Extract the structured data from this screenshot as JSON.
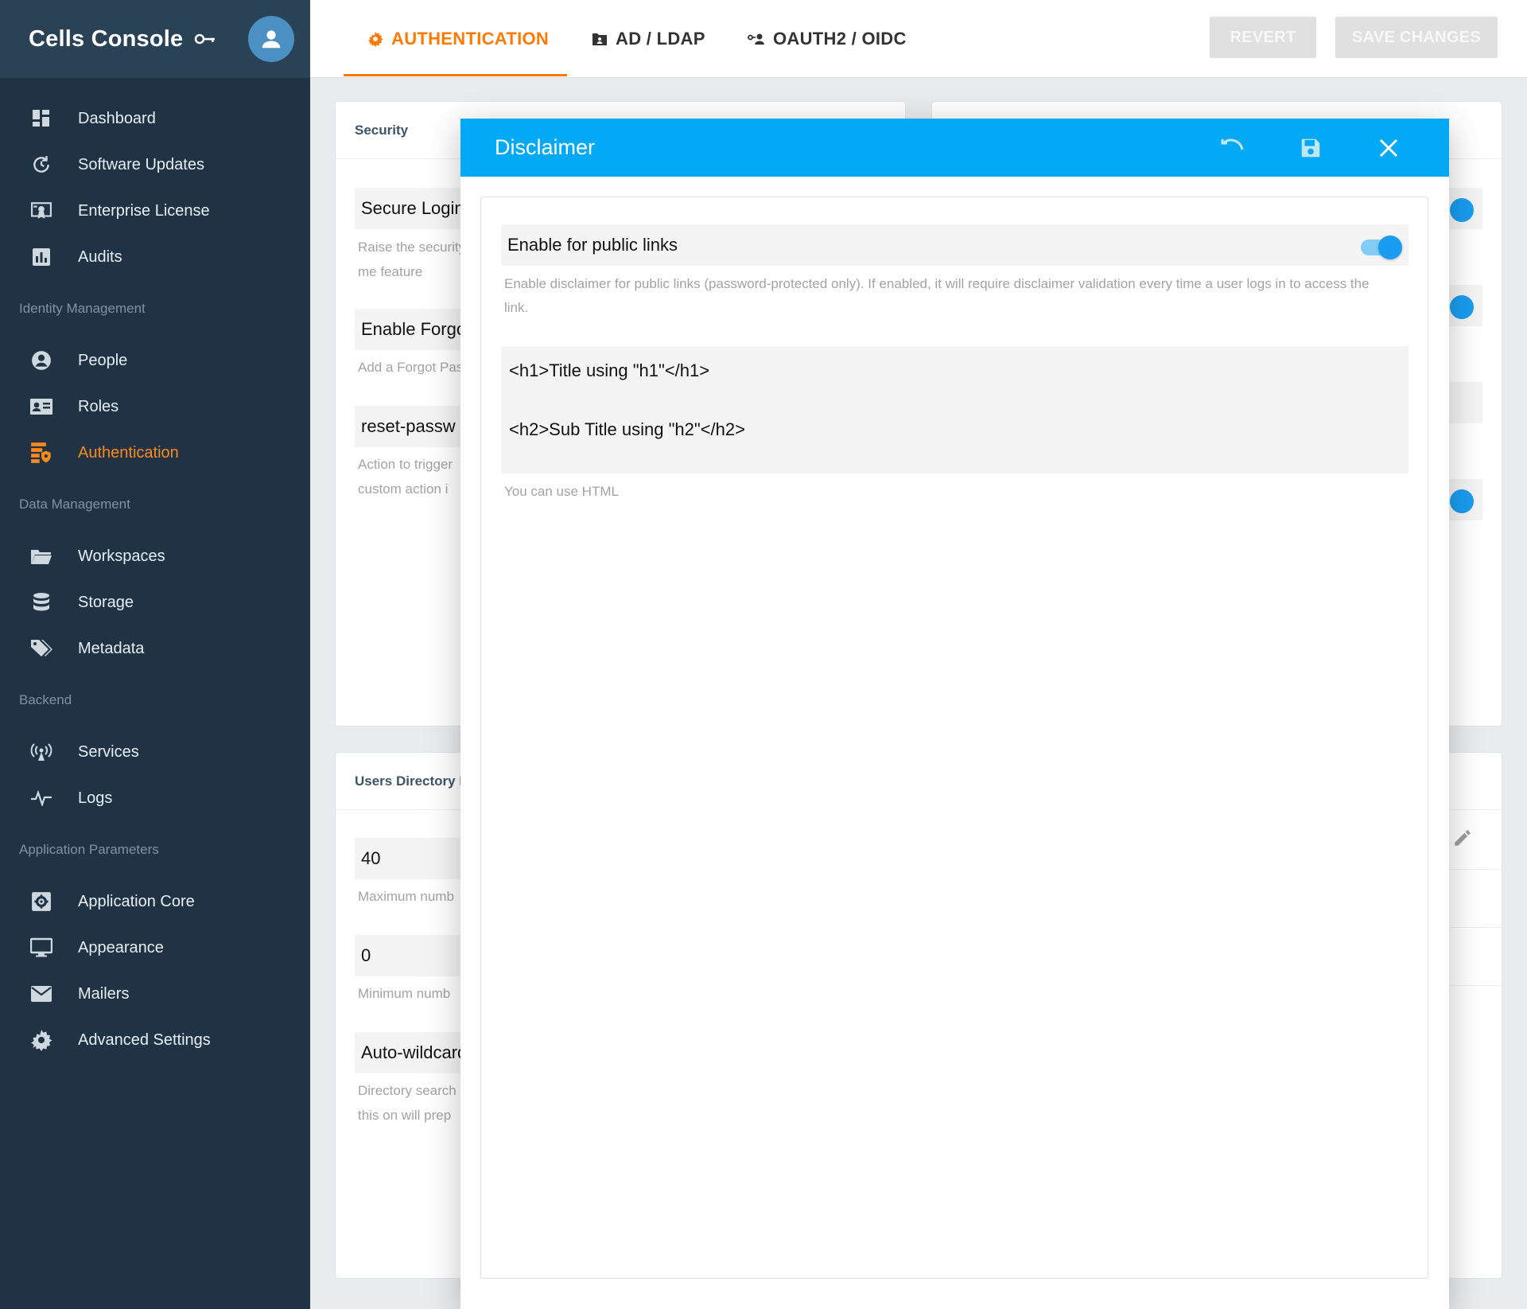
{
  "app": {
    "title": "Cells Console"
  },
  "sidebar": {
    "groups": [
      {
        "items": [
          {
            "label": "Dashboard",
            "icon": "dashboard-icon"
          },
          {
            "label": "Software Updates",
            "icon": "update-icon"
          },
          {
            "label": "Enterprise License",
            "icon": "license-icon"
          },
          {
            "label": "Audits",
            "icon": "audits-icon"
          }
        ]
      },
      {
        "section": "Identity Management",
        "items": [
          {
            "label": "People",
            "icon": "person-icon"
          },
          {
            "label": "Roles",
            "icon": "roles-icon"
          },
          {
            "label": "Authentication",
            "icon": "authentication-icon",
            "active": true
          }
        ]
      },
      {
        "section": "Data Management",
        "items": [
          {
            "label": "Workspaces",
            "icon": "folder-icon"
          },
          {
            "label": "Storage",
            "icon": "storage-icon"
          },
          {
            "label": "Metadata",
            "icon": "tags-icon"
          }
        ]
      },
      {
        "section": "Backend",
        "items": [
          {
            "label": "Services",
            "icon": "services-icon"
          },
          {
            "label": "Logs",
            "icon": "logs-icon"
          }
        ]
      },
      {
        "section": "Application Parameters",
        "items": [
          {
            "label": "Application Core",
            "icon": "app-core-icon"
          },
          {
            "label": "Appearance",
            "icon": "monitor-icon"
          },
          {
            "label": "Mailers",
            "icon": "mail-icon"
          },
          {
            "label": "Advanced Settings",
            "icon": "gear-icon"
          }
        ]
      }
    ]
  },
  "tabs": [
    {
      "label": "AUTHENTICATION",
      "icon": "gear-icon",
      "active": true
    },
    {
      "label": "AD / LDAP",
      "icon": "ldap-icon"
    },
    {
      "label": "OAUTH2 / OIDC",
      "icon": "oauth-icon"
    }
  ],
  "toolbar": {
    "revert_label": "REVERT",
    "save_label": "SAVE CHANGES"
  },
  "security_card": {
    "title": "Security",
    "fields": [
      {
        "value": "Secure Login",
        "hint": [
          "Raise the security",
          "me feature"
        ]
      },
      {
        "value": "Enable Forgot",
        "hint": [
          "Add a Forgot Pass"
        ]
      },
      {
        "value": "reset-passw",
        "hint": [
          "Action to trigger",
          "custom action i"
        ]
      }
    ]
  },
  "users_card": {
    "title": "Users Directory L",
    "fields": [
      {
        "value": "40",
        "hint": [
          "Maximum numb"
        ]
      },
      {
        "value": "0",
        "hint": [
          "Minimum numb"
        ]
      },
      {
        "value": "Auto-wildcard",
        "hint": [
          "Directory search",
          "this on will prep"
        ]
      }
    ]
  },
  "dialog": {
    "title": "Disclaimer",
    "toggle_label": "Enable for public links",
    "toggle_on": true,
    "toggle_description": "Enable disclaimer for public links (password-protected only). If enabled, it will require disclaimer validation every time a user logs in to access the link.",
    "html_value": "<h1>Title using \"h1\"</h1>\n\n<h2>Sub Title using \"h2\"</h2>",
    "html_hint": "You can use HTML"
  },
  "colors": {
    "accent": "#ff7a00",
    "dialog_header": "#03a9f4",
    "sidebar": "#1f3345",
    "toggle": "#1a9df0"
  }
}
